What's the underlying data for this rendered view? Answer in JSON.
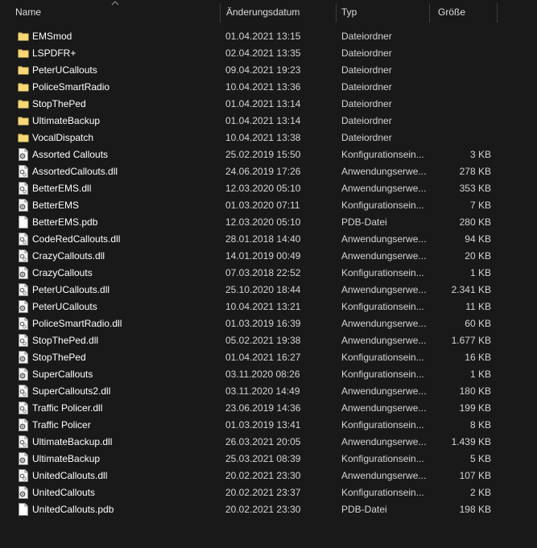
{
  "header": {
    "name_label": "Name",
    "date_label": "Änderungsdatum",
    "type_label": "Typ",
    "size_label": "Größe"
  },
  "files": [
    {
      "name": "EMSmod",
      "date": "01.04.2021 13:15",
      "type": "Dateiordner",
      "size": "",
      "icon": "folder-icon"
    },
    {
      "name": "LSPDFR+",
      "date": "02.04.2021 13:35",
      "type": "Dateiordner",
      "size": "",
      "icon": "folder-icon"
    },
    {
      "name": "PeterUCallouts",
      "date": "09.04.2021 19:23",
      "type": "Dateiordner",
      "size": "",
      "icon": "folder-icon"
    },
    {
      "name": "PoliceSmartRadio",
      "date": "10.04.2021 13:36",
      "type": "Dateiordner",
      "size": "",
      "icon": "folder-icon"
    },
    {
      "name": "StopThePed",
      "date": "01.04.2021 13:14",
      "type": "Dateiordner",
      "size": "",
      "icon": "folder-icon"
    },
    {
      "name": "UltimateBackup",
      "date": "01.04.2021 13:14",
      "type": "Dateiordner",
      "size": "",
      "icon": "folder-icon"
    },
    {
      "name": "VocalDispatch",
      "date": "10.04.2021 13:38",
      "type": "Dateiordner",
      "size": "",
      "icon": "folder-icon"
    },
    {
      "name": "Assorted Callouts",
      "date": "25.02.2019 15:50",
      "type": "Konfigurationsein...",
      "size": "3 KB",
      "icon": "config-file-icon"
    },
    {
      "name": "AssortedCallouts.dll",
      "date": "24.06.2019 17:26",
      "type": "Anwendungserwe...",
      "size": "278 KB",
      "icon": "dll-file-icon"
    },
    {
      "name": "BetterEMS.dll",
      "date": "12.03.2020 05:10",
      "type": "Anwendungserwe...",
      "size": "353 KB",
      "icon": "dll-file-icon"
    },
    {
      "name": "BetterEMS",
      "date": "01.03.2020 07:11",
      "type": "Konfigurationsein...",
      "size": "7 KB",
      "icon": "config-file-icon"
    },
    {
      "name": "BetterEMS.pdb",
      "date": "12.03.2020 05:10",
      "type": "PDB-Datei",
      "size": "280 KB",
      "icon": "blank-file-icon"
    },
    {
      "name": "CodeRedCallouts.dll",
      "date": "28.01.2018 14:40",
      "type": "Anwendungserwe...",
      "size": "94 KB",
      "icon": "dll-file-icon"
    },
    {
      "name": "CrazyCallouts.dll",
      "date": "14.01.2019 00:49",
      "type": "Anwendungserwe...",
      "size": "20 KB",
      "icon": "dll-file-icon"
    },
    {
      "name": "CrazyCallouts",
      "date": "07.03.2018 22:52",
      "type": "Konfigurationsein...",
      "size": "1 KB",
      "icon": "config-file-icon"
    },
    {
      "name": "PeterUCallouts.dll",
      "date": "25.10.2020 18:44",
      "type": "Anwendungserwe...",
      "size": "2.341 KB",
      "icon": "dll-file-icon"
    },
    {
      "name": "PeterUCallouts",
      "date": "10.04.2021 13:21",
      "type": "Konfigurationsein...",
      "size": "11 KB",
      "icon": "config-file-icon"
    },
    {
      "name": "PoliceSmartRadio.dll",
      "date": "01.03.2019 16:39",
      "type": "Anwendungserwe...",
      "size": "60 KB",
      "icon": "dll-file-icon"
    },
    {
      "name": "StopThePed.dll",
      "date": "05.02.2021 19:38",
      "type": "Anwendungserwe...",
      "size": "1.677 KB",
      "icon": "dll-file-icon"
    },
    {
      "name": "StopThePed",
      "date": "01.04.2021 16:27",
      "type": "Konfigurationsein...",
      "size": "16 KB",
      "icon": "config-file-icon"
    },
    {
      "name": "SuperCallouts",
      "date": "03.11.2020 08:26",
      "type": "Konfigurationsein...",
      "size": "1 KB",
      "icon": "config-file-icon"
    },
    {
      "name": "SuperCallouts2.dll",
      "date": "03.11.2020 14:49",
      "type": "Anwendungserwe...",
      "size": "180 KB",
      "icon": "dll-file-icon"
    },
    {
      "name": "Traffic Policer.dll",
      "date": "23.06.2019 14:36",
      "type": "Anwendungserwe...",
      "size": "199 KB",
      "icon": "dll-file-icon"
    },
    {
      "name": "Traffic Policer",
      "date": "01.03.2019 13:41",
      "type": "Konfigurationsein...",
      "size": "8 KB",
      "icon": "config-file-icon"
    },
    {
      "name": "UltimateBackup.dll",
      "date": "26.03.2021 20:05",
      "type": "Anwendungserwe...",
      "size": "1.439 KB",
      "icon": "dll-file-icon"
    },
    {
      "name": "UltimateBackup",
      "date": "25.03.2021 08:39",
      "type": "Konfigurationsein...",
      "size": "5 KB",
      "icon": "config-file-icon"
    },
    {
      "name": "UnitedCallouts.dll",
      "date": "20.02.2021 23:30",
      "type": "Anwendungserwe...",
      "size": "107 KB",
      "icon": "dll-file-icon"
    },
    {
      "name": "UnitedCallouts",
      "date": "20.02.2021 23:37",
      "type": "Konfigurationsein...",
      "size": "2 KB",
      "icon": "config-file-icon"
    },
    {
      "name": "UnitedCallouts.pdb",
      "date": "20.02.2021 23:30",
      "type": "PDB-Datei",
      "size": "198 KB",
      "icon": "blank-file-icon"
    }
  ],
  "colors": {
    "background": "#191919",
    "folder": "#f8d775",
    "text": "#ffffff"
  }
}
